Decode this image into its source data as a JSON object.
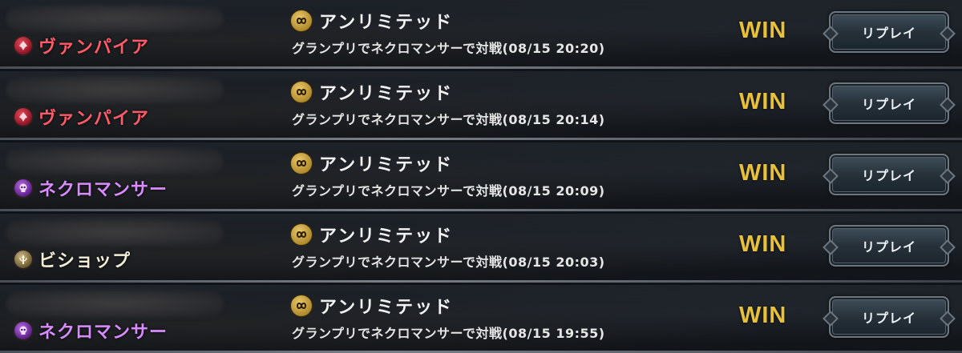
{
  "matches": [
    {
      "class_label": "ヴァンパイア",
      "class_icon": "vampire-class-icon",
      "class_color": "#ff5a6a",
      "format_label": "アンリミテッド",
      "format_icon": "infinity-icon",
      "description": "グランプリでネクロマンサーで対戦(08/15 20:20)",
      "result": "WIN",
      "replay_label": "リプレイ"
    },
    {
      "class_label": "ヴァンパイア",
      "class_icon": "vampire-class-icon",
      "class_color": "#ff5a6a",
      "format_label": "アンリミテッド",
      "format_icon": "infinity-icon",
      "description": "グランプリでネクロマンサーで対戦(08/15 20:14)",
      "result": "WIN",
      "replay_label": "リプレイ"
    },
    {
      "class_label": "ネクロマンサー",
      "class_icon": "necromancer-class-icon",
      "class_color": "#d98cff",
      "format_label": "アンリミテッド",
      "format_icon": "infinity-icon",
      "description": "グランプリでネクロマンサーで対戦(08/15 20:09)",
      "result": "WIN",
      "replay_label": "リプレイ"
    },
    {
      "class_label": "ビショップ",
      "class_icon": "bishop-class-icon",
      "class_color": "#f3ecd8",
      "format_label": "アンリミテッド",
      "format_icon": "infinity-icon",
      "description": "グランプリでネクロマンサーで対戦(08/15 20:03)",
      "result": "WIN",
      "replay_label": "リプレイ"
    },
    {
      "class_label": "ネクロマンサー",
      "class_icon": "necromancer-class-icon",
      "class_color": "#d98cff",
      "format_label": "アンリミテッド",
      "format_icon": "infinity-icon",
      "description": "グランプリでネクロマンサーで対戦(08/15 19:55)",
      "result": "WIN",
      "replay_label": "リプレイ"
    }
  ],
  "colors": {
    "win": "#e8c13a",
    "vampire": "#ff5a6a",
    "necromancer": "#d98cff",
    "bishop": "#f3ecd8"
  }
}
